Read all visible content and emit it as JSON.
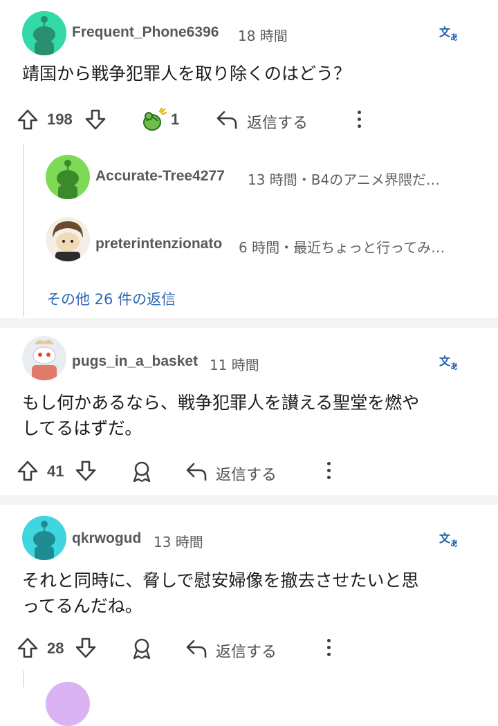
{
  "comments": [
    {
      "username": "Frequent_Phone6396",
      "time": "18 時間",
      "body": "靖国から戦争犯罪人を取り除くのはどう？",
      "upvotes": "198",
      "award_count": "1",
      "reply_label": "返信する",
      "avatar_color": "#33d9a6",
      "replies": [
        {
          "username": "Accurate-Tree4277",
          "meta": "13 時間・B4のアニメ界隈だ…",
          "avatar_color": "#7ed957"
        },
        {
          "username": "preterintenzionato",
          "meta": "6 時間・最近ちょっと行ってみ…",
          "avatar_color": "#f4efe6"
        }
      ],
      "more_replies": "その他 26 件の返信"
    },
    {
      "username": "pugs_in_a_basket",
      "time": "11 時間",
      "body_lines": [
        "もし何かあるなら、戦争犯罪人を讃える聖堂を燃や",
        "してるはずだ。"
      ],
      "upvotes": "41",
      "reply_label": "返信する",
      "avatar_color": "#e9edef"
    },
    {
      "username": "qkrwogud",
      "time": "13 時間",
      "body_lines": [
        "それと同時に、脅しで慰安婦像を撤去させたいと思",
        "ってるんだね。"
      ],
      "upvotes": "28",
      "reply_label": "返信する",
      "avatar_color": "#3fd6e0"
    }
  ],
  "icons": {
    "translate": "translate-icon",
    "upvote": "upvote-arrow-icon",
    "downvote": "downvote-arrow-icon",
    "award": "award-icon",
    "reply": "reply-arrow-icon",
    "more": "more-options-icon"
  }
}
